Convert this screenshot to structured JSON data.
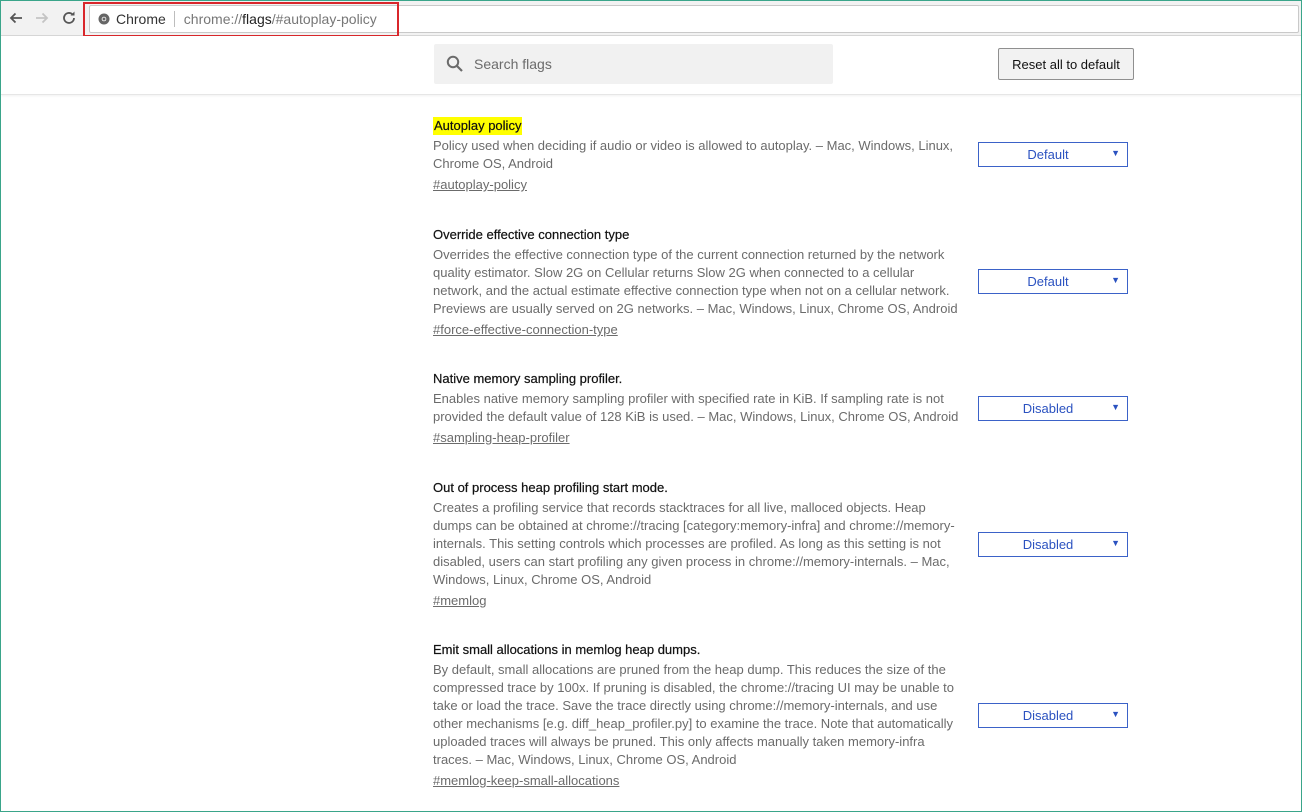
{
  "browser": {
    "chip_label": "Chrome",
    "url_scheme": "chrome://",
    "url_host": "flags",
    "url_path": "/#autoplay-policy"
  },
  "header": {
    "search_placeholder": "Search flags",
    "reset_label": "Reset all to default"
  },
  "experiments": [
    {
      "title": "Autoplay policy",
      "description": "Policy used when deciding if audio or video is allowed to autoplay. – Mac, Windows, Linux, Chrome OS, Android",
      "link": "#autoplay-policy",
      "value": "Default"
    },
    {
      "title": "Override effective connection type",
      "description": "Overrides the effective connection type of the current connection returned by the network quality estimator. Slow 2G on Cellular returns Slow 2G when connected to a cellular network, and the actual estimate effective connection type when not on a cellular network. Previews are usually served on 2G networks. – Mac, Windows, Linux, Chrome OS, Android",
      "link": "#force-effective-connection-type",
      "value": "Default"
    },
    {
      "title": "Native memory sampling profiler.",
      "description": "Enables native memory sampling profiler with specified rate in KiB. If sampling rate is not provided the default value of 128 KiB is used. – Mac, Windows, Linux, Chrome OS, Android",
      "link": "#sampling-heap-profiler",
      "value": "Disabled"
    },
    {
      "title": "Out of process heap profiling start mode.",
      "description": "Creates a profiling service that records stacktraces for all live, malloced objects. Heap dumps can be obtained at chrome://tracing [category:memory-infra] and chrome://memory-internals. This setting controls which processes are profiled. As long as this setting is not disabled, users can start profiling any given process in chrome://memory-internals. – Mac, Windows, Linux, Chrome OS, Android",
      "link": "#memlog",
      "value": "Disabled"
    },
    {
      "title": "Emit small allocations in memlog heap dumps.",
      "description": "By default, small allocations are pruned from the heap dump. This reduces the size of the compressed trace by 100x. If pruning is disabled, the chrome://tracing UI may be unable to take or load the trace. Save the trace directly using chrome://memory-internals, and use other mechanisms [e.g. diff_heap_profiler.py] to examine the trace. Note that automatically uploaded traces will always be pruned. This only affects manually taken memory-infra traces. – Mac, Windows, Linux, Chrome OS, Android",
      "link": "#memlog-keep-small-allocations",
      "value": "Disabled"
    }
  ],
  "colors": {
    "title_highlight": "#ffff00",
    "select_accent": "#2b52c0",
    "annotation_box": "#d9262b"
  }
}
